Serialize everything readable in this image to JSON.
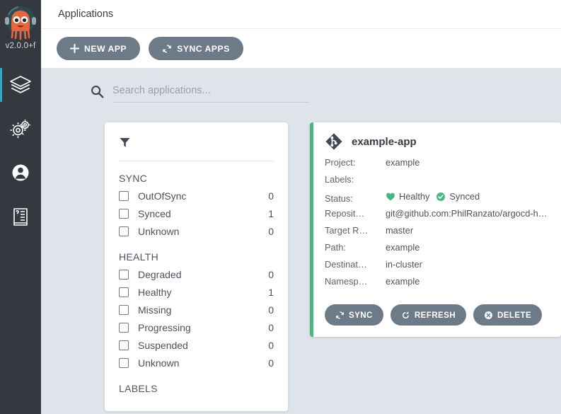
{
  "sidebar": {
    "version": "v2.0.0+f",
    "logo_icon": "argo-octopus-logo",
    "items": [
      {
        "id": "applications",
        "icon": "layers-icon",
        "active": true
      },
      {
        "id": "settings",
        "icon": "gears-icon",
        "active": false
      },
      {
        "id": "user-info",
        "icon": "user-circle-icon",
        "active": false
      },
      {
        "id": "documentation",
        "icon": "book-question-icon",
        "active": false
      }
    ]
  },
  "header": {
    "title": "Applications"
  },
  "toolbar": {
    "new_app_label": "NEW APP",
    "new_app_icon": "plus-icon",
    "sync_apps_label": "SYNC APPS",
    "sync_apps_icon": "sync-icon"
  },
  "search": {
    "placeholder": "Search applications...",
    "value": "",
    "icon": "search-icon"
  },
  "filters": {
    "icon": "funnel-icon",
    "sections": [
      {
        "title": "SYNC",
        "options": [
          {
            "label": "OutOfSync",
            "count": "0",
            "checked": false
          },
          {
            "label": "Synced",
            "count": "1",
            "checked": false
          },
          {
            "label": "Unknown",
            "count": "0",
            "checked": false
          }
        ]
      },
      {
        "title": "HEALTH",
        "options": [
          {
            "label": "Degraded",
            "count": "0",
            "checked": false
          },
          {
            "label": "Healthy",
            "count": "1",
            "checked": false
          },
          {
            "label": "Missing",
            "count": "0",
            "checked": false
          },
          {
            "label": "Progressing",
            "count": "0",
            "checked": false
          },
          {
            "label": "Suspended",
            "count": "0",
            "checked": false
          },
          {
            "label": "Unknown",
            "count": "0",
            "checked": false
          }
        ]
      },
      {
        "title": "LABELS",
        "options": []
      }
    ]
  },
  "colors": {
    "accent_green": "#45b883",
    "sidebar_bg": "#33393f",
    "active_indicator": "#2fa8c6",
    "button_gray": "#6d7b88",
    "content_bg": "#dee4e9"
  },
  "applications": [
    {
      "name": "example-app",
      "icon": "git-diamond-icon",
      "accent": "#45b883",
      "fields": [
        {
          "key": "Project:",
          "value": "example"
        },
        {
          "key": "Labels:",
          "value": ""
        },
        {
          "key": "Status:",
          "value": ""
        },
        {
          "key": "Reposit…",
          "value": "git@github.com:PhilRanzato/argocd-he…"
        },
        {
          "key": "Target R…",
          "value": "master"
        },
        {
          "key": "Path:",
          "value": "example"
        },
        {
          "key": "Destinat…",
          "value": "in-cluster"
        },
        {
          "key": "Namesp…",
          "value": "example"
        }
      ],
      "status": {
        "health_label": "Healthy",
        "health_icon": "heart-icon",
        "sync_label": "Synced",
        "sync_icon": "check-circle-icon"
      },
      "actions": [
        {
          "label": "SYNC",
          "icon": "sync-icon"
        },
        {
          "label": "REFRESH",
          "icon": "refresh-icon"
        },
        {
          "label": "DELETE",
          "icon": "delete-circle-icon"
        }
      ]
    }
  ]
}
